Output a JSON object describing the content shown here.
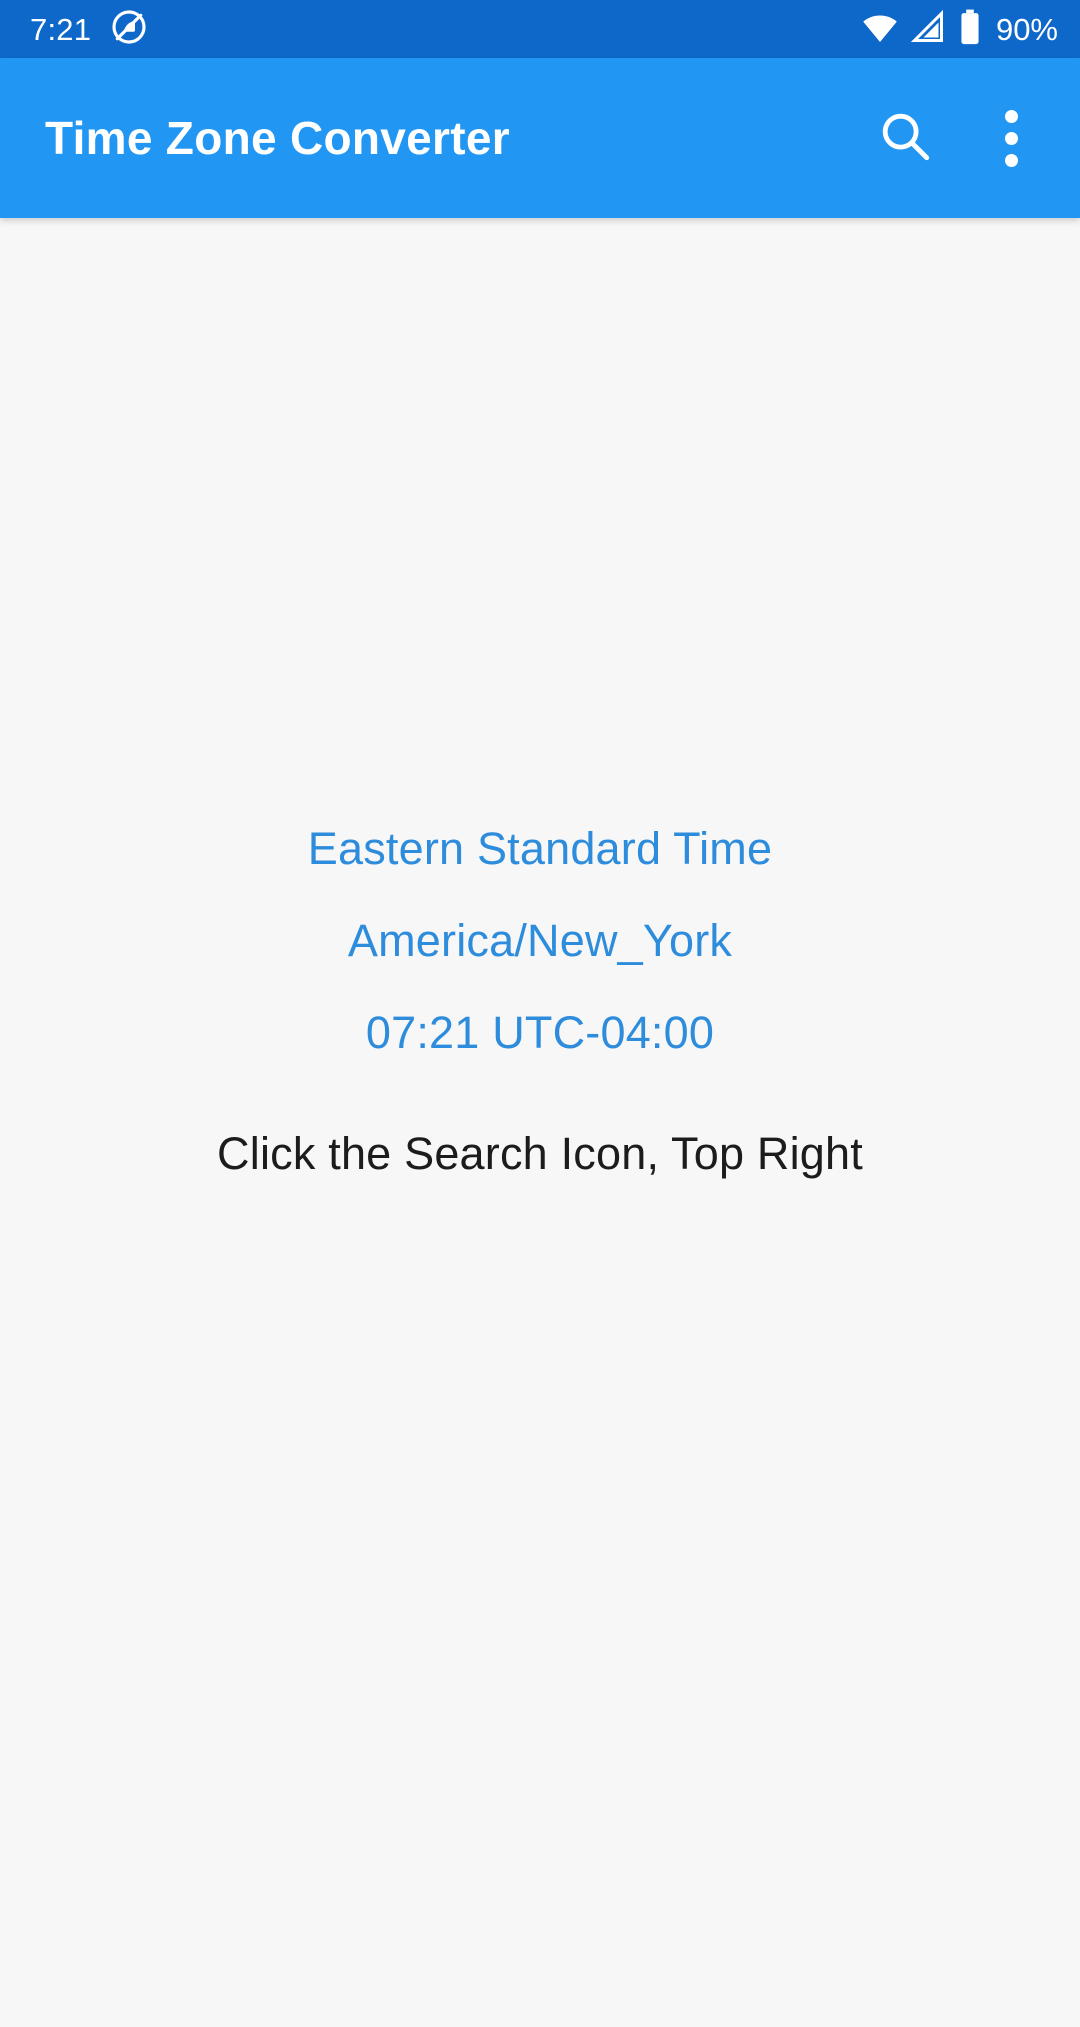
{
  "status_bar": {
    "clock": "7:21",
    "battery_percent": "90%",
    "icons": [
      "app-circle-icon",
      "wifi-icon",
      "cellular-signal-icon",
      "battery-icon"
    ],
    "background_color": "#0d68c9",
    "foreground_color": "#ffffff"
  },
  "app_bar": {
    "title": "Time Zone Converter",
    "background_color": "#2196f3",
    "title_color": "#ffffff",
    "actions": [
      {
        "name": "search",
        "icon": "search-icon"
      },
      {
        "name": "overflow",
        "icon": "more-vertical-icon"
      }
    ]
  },
  "main": {
    "background_color": "#f7f7f7",
    "accent_color": "#2d8cdb",
    "zone": {
      "name": "Eastern Standard Time",
      "id": "America/New_York",
      "time_offset": "07:21 UTC-04:00"
    },
    "hint": "Click the Search Icon, Top Right",
    "hint_color": "#1c1c1c"
  }
}
